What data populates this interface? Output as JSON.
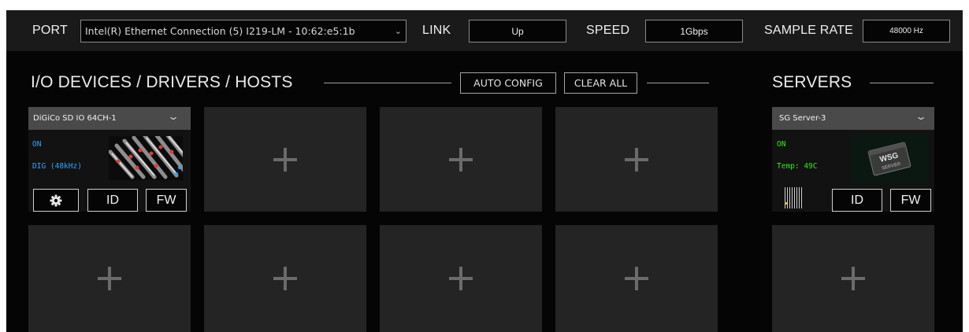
{
  "topbar": {
    "port_label": "PORT",
    "port_value": "Intel(R) Ethernet Connection (5) I219-LM - 10:62:e5:1b",
    "link_label": "LINK",
    "link_value": "Up",
    "speed_label": "SPEED",
    "speed_value": "1Gbps",
    "sample_rate_label": "SAMPLE RATE",
    "sample_rate_value": "48000 Hz"
  },
  "io_section": {
    "title": "I/O DEVICES / DRIVERS / HOSTS",
    "auto_config_label": "AUTO CONFIG",
    "clear_all_label": "CLEAR ALL"
  },
  "io_device": {
    "name": "DiGiCo SD IO 64CH-1",
    "status": "ON",
    "mode": "DIG (48kHz)",
    "id_label": "ID",
    "fw_label": "FW"
  },
  "servers_section": {
    "title": "SERVERS"
  },
  "server": {
    "name": "SG Server-3",
    "status": "ON",
    "temp": "Temp: 49C",
    "logo_text": "WSG",
    "logo_subtext": "SERVER",
    "id_label": "ID",
    "fw_label": "FW"
  },
  "colors": {
    "accent_on_io": "#2aa8ff",
    "accent_on_server": "#35e81c",
    "panel_bg": "#242424",
    "background": "#050505"
  },
  "icons": {
    "settings": "gear-icon",
    "add": "plus-icon",
    "dropdown": "chevron-down-icon",
    "meter": "level-meter-icon"
  }
}
